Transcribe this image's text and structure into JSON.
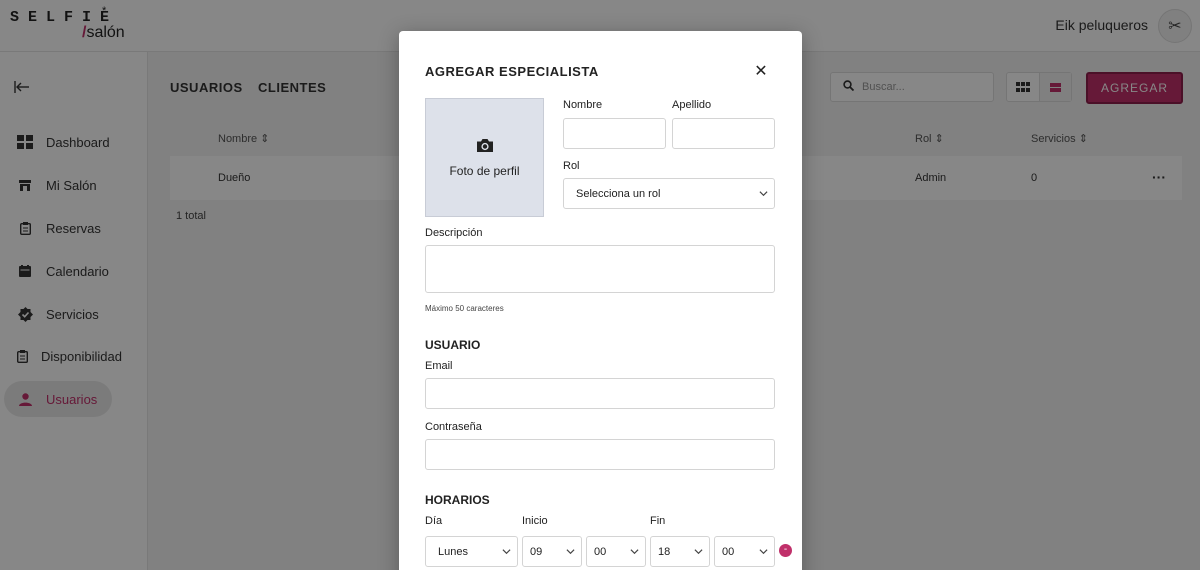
{
  "app": {
    "logo_top": "SELFIE",
    "logo_star": "*",
    "logo_bottom": "salón",
    "logo_slash": "/",
    "org_name": "Eik peluqueros",
    "avatar_glyph": "✂",
    "brand_color": "#c0306a"
  },
  "sidebar": {
    "collapse_icon": "collapse-arrow-icon",
    "items": [
      {
        "label": "Dashboard",
        "icon": "dashboard-icon"
      },
      {
        "label": "Mi Salón",
        "icon": "store-icon"
      },
      {
        "label": "Reservas",
        "icon": "clipboard-icon"
      },
      {
        "label": "Calendario",
        "icon": "calendar-icon"
      },
      {
        "label": "Servicios",
        "icon": "verified-badge-icon"
      },
      {
        "label": "Disponibilidad",
        "icon": "clipboard-icon"
      },
      {
        "label": "Usuarios",
        "icon": "person-icon",
        "active": true
      }
    ]
  },
  "main": {
    "tabs": [
      "USUARIOS",
      "CLIENTES"
    ],
    "search_placeholder": "Buscar...",
    "add_button": "AGREGAR",
    "columns": [
      "Nombre",
      "Rol",
      "Servicios"
    ],
    "sort_glyph": "⇕",
    "rows": [
      {
        "nombre": "Dueño",
        "rol": "Admin",
        "servicios": "0",
        "menu": "···"
      }
    ],
    "total": "1 total"
  },
  "modal": {
    "title": "AGREGAR ESPECIALISTA",
    "close": "✕",
    "photo_label": "Foto de perfil",
    "nombre_label": "Nombre",
    "apellido_label": "Apellido",
    "rol_label": "Rol",
    "rol_value": "Selecciona un rol",
    "descripcion_label": "Descripción",
    "descripcion_hint": "Máximo 50 caracteres",
    "usuario_section": "USUARIO",
    "email_label": "Email",
    "password_label": "Contraseña",
    "horarios_section": "HORARIOS",
    "dia_label": "Día",
    "inicio_label": "Inicio",
    "fin_label": "Fin",
    "schedule": {
      "dia": "Lunes",
      "inicio_h": "09",
      "inicio_m": "00",
      "fin_h": "18",
      "fin_m": "00"
    },
    "remove_glyph": "-"
  }
}
